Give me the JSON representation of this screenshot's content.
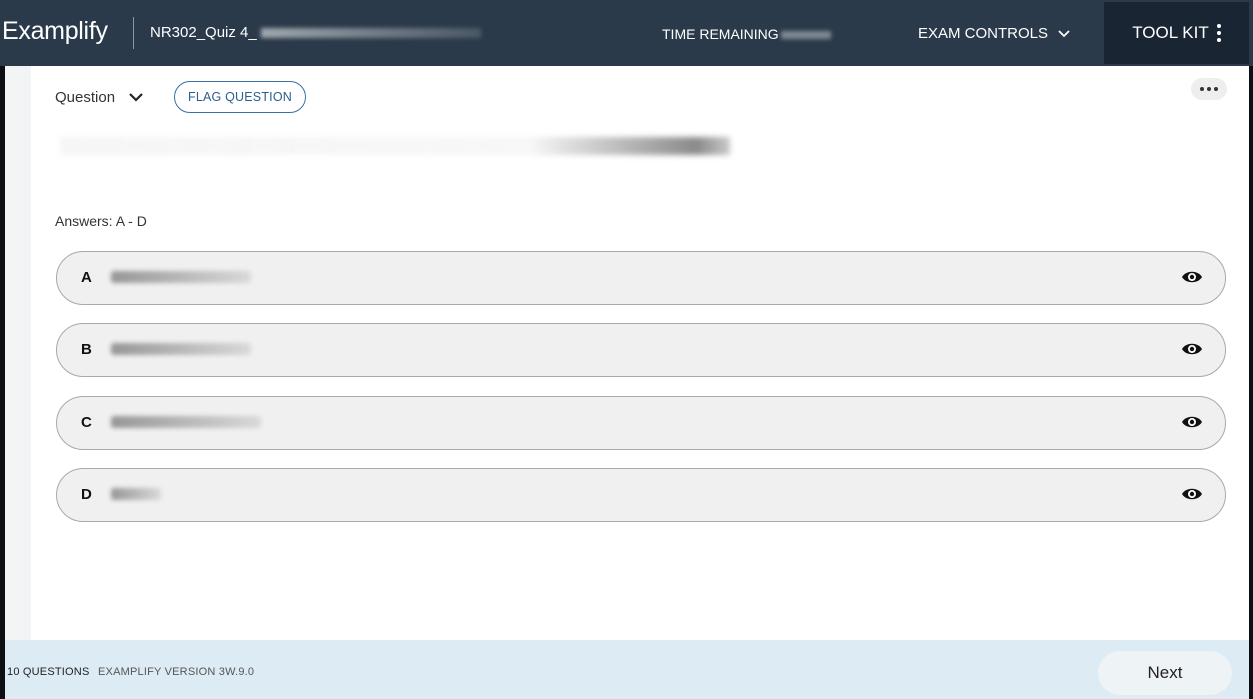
{
  "header": {
    "brand": "Examplify",
    "exam_title": "NR302_Quiz 4_",
    "time_remaining_label": "TIME REMAINING",
    "exam_controls_label": "EXAM CONTROLS",
    "toolkit_label": "TOOL KIT"
  },
  "question": {
    "selector_label": "Question",
    "flag_label": "FLAG QUESTION",
    "answers_label": "Answers: A - D"
  },
  "options": [
    {
      "letter": "A"
    },
    {
      "letter": "B"
    },
    {
      "letter": "C"
    },
    {
      "letter": "D"
    }
  ],
  "footer": {
    "question_count": "10 QUESTIONS",
    "version": "EXAMPLIFY VERSION 3W.9.0",
    "next_label": "Next"
  },
  "icons": {
    "exam_controls": "chevron-down-icon",
    "toolkit": "kebab-vertical-icon",
    "more": "more-horizontal-icon",
    "option_eye": "eye-icon"
  },
  "colors": {
    "header_bg": "#2b3a4a",
    "toolkit_bg": "#1a2533",
    "accent": "#3d6fa1",
    "footer_bg": "#dcebf4"
  }
}
